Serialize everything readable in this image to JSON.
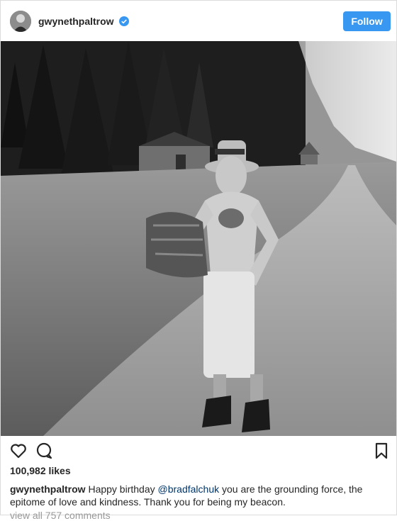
{
  "post": {
    "username": "gwynethpaltrow",
    "follow_label": "Follow",
    "likes": "100,982 likes",
    "caption": {
      "username": "gwynethpaltrow",
      "text_before": "Happy birthday",
      "mention": "@bradfalchuk",
      "text_after": "you are the grounding force, the epitome of love and kindness. Thank you for being my beacon."
    },
    "view_comments": "view all 757 comments"
  },
  "colors": {
    "accent": "#3897f0",
    "text": "#262626",
    "muted": "#999999",
    "mention": "#003569"
  },
  "icons": [
    "verified-badge-icon",
    "heart-icon",
    "comment-icon",
    "bookmark-icon"
  ]
}
